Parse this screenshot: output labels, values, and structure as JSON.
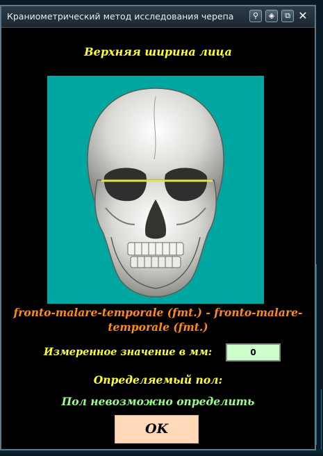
{
  "window": {
    "title": "Краниометрический метод исследования черепа",
    "title_buttons": [
      "pin-icon",
      "settings-icon",
      "restore-icon",
      "close-icon"
    ],
    "close_glyph": "✕"
  },
  "content": {
    "heading": "Верхняя ширина лица",
    "measurement_points": "fronto-malare-temporale (fmt.) - fronto-malare-temporale (fmt.)",
    "value_label": "Измеренное значение в мм:",
    "value": "0",
    "sex_label": "Определяемый пол:",
    "sex_result": "Пол невозможно определить",
    "ok_label": "OK"
  },
  "colors": {
    "heading": "#ffff33",
    "measurement_points": "#ff8a1c",
    "sex_result": "#99ff88",
    "image_background": "#00a7a0",
    "value_field": "#ccffcc",
    "ok_button": "#ffd9b8",
    "measure_line": "#e8e04a"
  }
}
